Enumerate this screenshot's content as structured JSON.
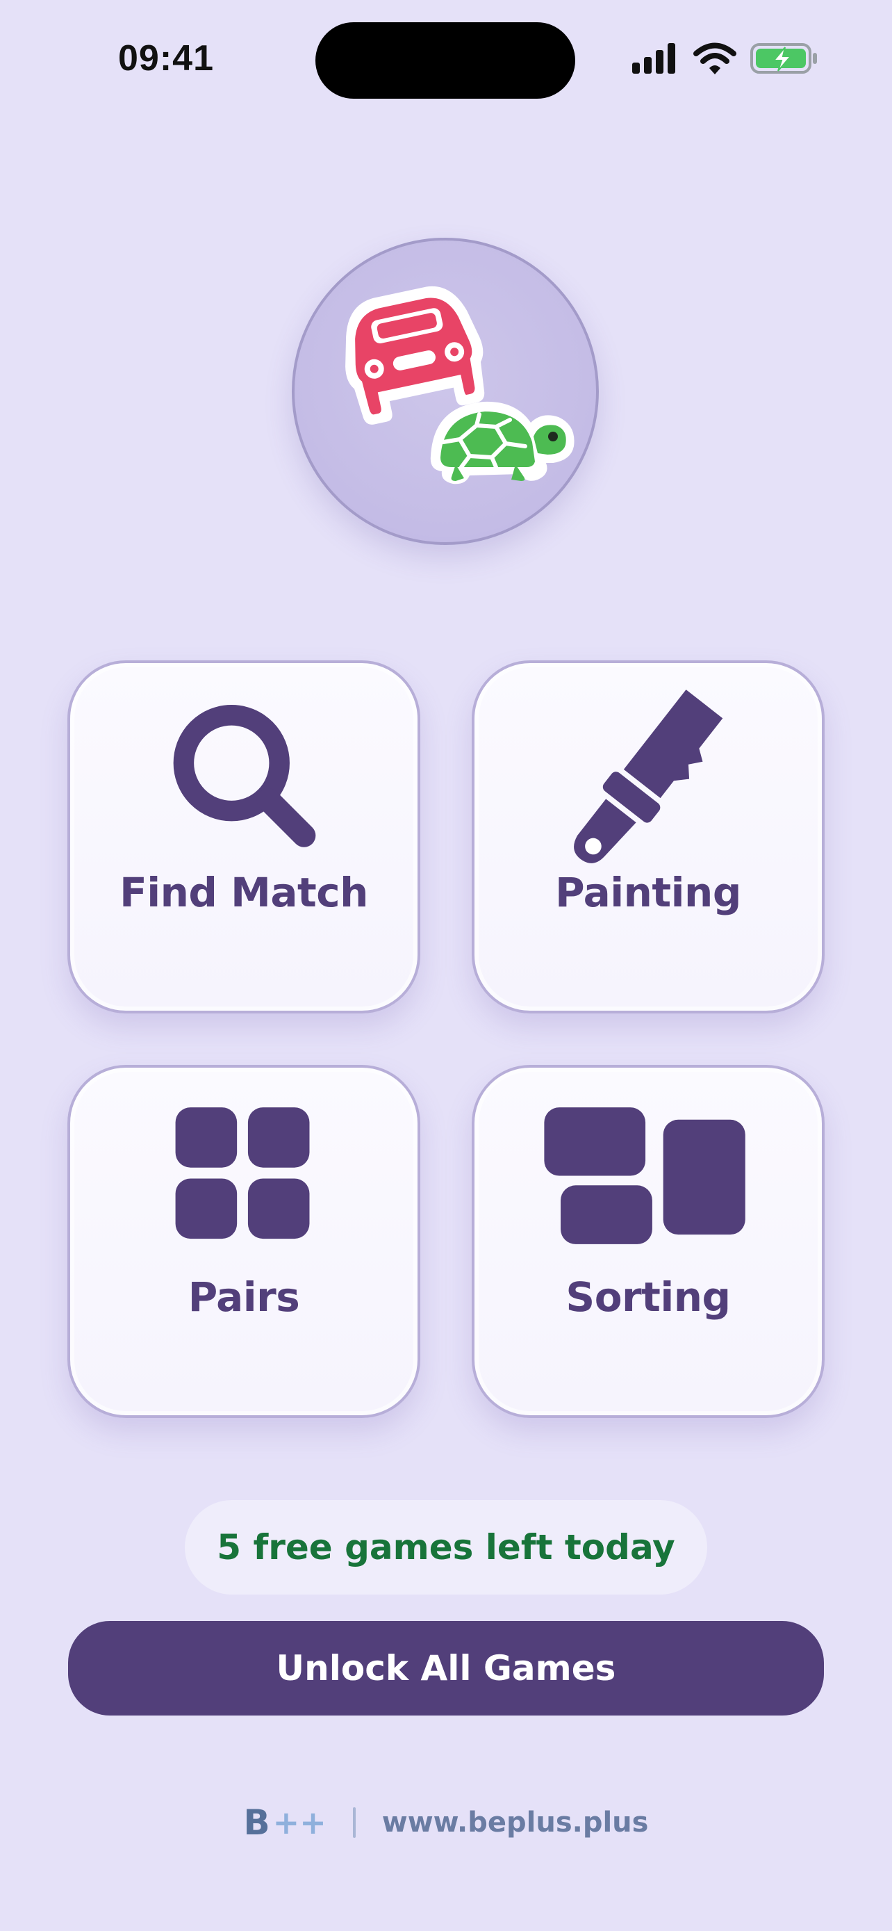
{
  "status_bar": {
    "time": "09:41",
    "icons": [
      "cellular-signal-icon",
      "wifi-icon",
      "battery-charging-icon"
    ],
    "battery_color": "#4cc764"
  },
  "logo": {
    "icons": [
      "car-icon",
      "turtle-icon"
    ],
    "colors": {
      "car": "#e84466",
      "turtle": "#4dbb52"
    }
  },
  "games": [
    {
      "label": "Find Match",
      "icon": "magnifier-icon"
    },
    {
      "label": "Painting",
      "icon": "paintbrush-icon"
    },
    {
      "label": "Pairs",
      "icon": "four-squares-icon"
    },
    {
      "label": "Sorting",
      "icon": "sorting-blocks-icon"
    }
  ],
  "free_games_text": "5 free games left today",
  "unlock_button_label": "Unlock All Games",
  "footer": {
    "brand": "B",
    "brand_plus": "++",
    "url": "www.beplus.plus"
  },
  "colors": {
    "background": "#e5e1f8",
    "primary": "#523f7a",
    "free_text": "#18743a",
    "footer_text": "#6a7ca3"
  }
}
